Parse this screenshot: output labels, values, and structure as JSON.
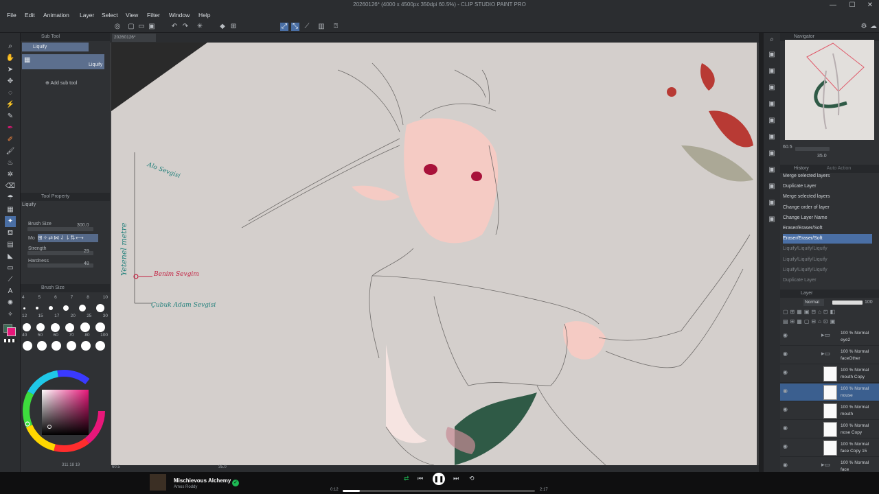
{
  "window": {
    "title": "20260126* (4000 x 4500px 350dpi 60.5%) - CLIP STUDIO PAINT PRO",
    "minimize": "—",
    "maximize": "☐",
    "close": "✕"
  },
  "menu": [
    "File",
    "Edit",
    "Animation",
    "Layer",
    "Select",
    "View",
    "Filter",
    "Window",
    "Help"
  ],
  "document_tab": "20260126*",
  "sub_tool": {
    "header": "Sub Tool",
    "group": "Liquify",
    "item_label": "Liquify",
    "add_label": "Add sub tool"
  },
  "tool_property": {
    "header": "Tool Property",
    "name": "Liquify",
    "brush_size_label": "Brush Size",
    "brush_size_value": "300.0",
    "mode_label": "Mo",
    "strength_label": "Strength",
    "strength_value": "29",
    "hardness_label": "Hardness",
    "hardness_value": "48"
  },
  "brush_size_panel": {
    "header": "Brush Size",
    "row1": [
      "4",
      "5",
      "6",
      "7",
      "8",
      "10"
    ],
    "row2": [
      "12",
      "15",
      "17",
      "20",
      "25",
      "30"
    ],
    "row3": [
      "40",
      "50",
      "60",
      "70",
      "80",
      "100"
    ]
  },
  "annotations": {
    "top": "Alo Sevgisi",
    "vertical": "Yetenel metre",
    "mine": "Benim Sevgim",
    "bottom": "Çubuk Adam Sevgisi"
  },
  "navigator": {
    "header": "Navigator",
    "zoom": "60.5",
    "angle": "35.0"
  },
  "history": {
    "header": "History",
    "header_right": "Auto Action",
    "items": [
      {
        "label": "Merge selected layers",
        "state": "normal"
      },
      {
        "label": "Duplicate Layer",
        "state": "normal"
      },
      {
        "label": "Merge selected layers",
        "state": "normal"
      },
      {
        "label": "Change order of layer",
        "state": "normal"
      },
      {
        "label": "Change Layer Name",
        "state": "normal"
      },
      {
        "label": "Eraser/Eraser/Soft",
        "state": "normal"
      },
      {
        "label": "Eraser/Eraser/Soft",
        "state": "selected"
      },
      {
        "label": "Liquify/Liquify/Liquify",
        "state": "dim"
      },
      {
        "label": "Liquify/Liquify/Liquify",
        "state": "dim"
      },
      {
        "label": "Liquify/Liquify/Liquify",
        "state": "dim"
      },
      {
        "label": "Duplicate Layer",
        "state": "dim"
      }
    ]
  },
  "layer_panel": {
    "header": "Layer",
    "blend_mode": "Normal",
    "opacity": "100",
    "layers": [
      {
        "line1": "100 % Normal",
        "line2": "eye2",
        "type": "folder"
      },
      {
        "line1": "100 % Normal",
        "line2": "faceOther",
        "type": "folder"
      },
      {
        "line1": "100 % Normal",
        "line2": "mouth Copy",
        "type": "layer"
      },
      {
        "line1": "100 % Normal",
        "line2": "nouse",
        "type": "layer",
        "selected": true
      },
      {
        "line1": "100 % Normal",
        "line2": "mouth",
        "type": "layer"
      },
      {
        "line1": "100 % Normal",
        "line2": "nose Copy",
        "type": "layer"
      },
      {
        "line1": "100 % Normal",
        "line2": "face Copy 15",
        "type": "layer"
      },
      {
        "line1": "100 % Normal",
        "line2": "face",
        "type": "folder"
      },
      {
        "line1": "100 % Normal",
        "line2": "",
        "type": "layer"
      }
    ]
  },
  "status_bar": {
    "zoom": "60.5",
    "angle": "35.0",
    "left_info": "311 18 19"
  },
  "player": {
    "track": "Mischievous Alchemy",
    "artist": "Amos Roddy",
    "elapsed": "0:12",
    "duration": "2:17",
    "progress": 0.088
  },
  "colors": {
    "accent": "#4a6fa5",
    "main_color": "#e8177a",
    "sub_color": "#3d6a55",
    "spotify_green": "#1db954"
  }
}
